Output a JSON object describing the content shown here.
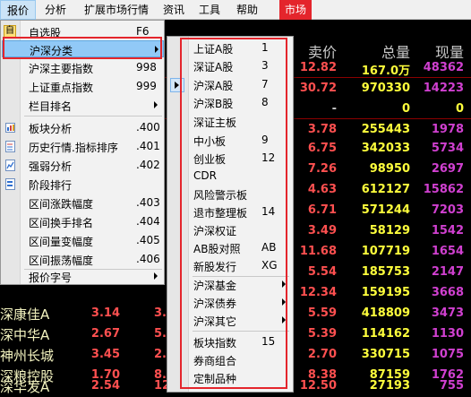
{
  "menubar": {
    "items": [
      {
        "label": "报价",
        "active": true
      },
      {
        "label": "分析"
      },
      {
        "label": "扩展市场行情"
      },
      {
        "label": "资讯"
      },
      {
        "label": "工具"
      },
      {
        "label": "帮助"
      },
      {
        "label": "市场",
        "accent": "#e4252c"
      }
    ]
  },
  "quote": {
    "headers": {
      "price": "卖价",
      "total_volume": "总量",
      "current_volume": "现量"
    },
    "rows": [
      {
        "price": "12.82",
        "volume": "167.0万",
        "now": "48362"
      },
      {
        "price": "30.72",
        "volume": "970330",
        "now": "14223"
      },
      {
        "price": "-",
        "volume": "0",
        "now": "0"
      },
      {
        "price": "3.78",
        "volume": "255443",
        "now": "1978"
      },
      {
        "price": "6.75",
        "volume": "342033",
        "now": "5734"
      },
      {
        "price": "7.26",
        "volume": "98950",
        "now": "2697"
      },
      {
        "price": "4.63",
        "volume": "612127",
        "now": "15862"
      },
      {
        "price": "6.71",
        "volume": "571244",
        "now": "7203"
      },
      {
        "price": "3.49",
        "volume": "58129",
        "now": "1542"
      },
      {
        "price": "11.68",
        "volume": "107719",
        "now": "1654"
      },
      {
        "price": "5.54",
        "volume": "185753",
        "now": "2147"
      },
      {
        "price": "12.34",
        "volume": "159195",
        "now": "3668"
      },
      {
        "price": "5.59",
        "volume": "418809",
        "now": "3473"
      },
      {
        "price": "5.39",
        "volume": "114162",
        "now": "1130"
      },
      {
        "price": "2.70",
        "volume": "330715",
        "now": "1075"
      },
      {
        "price": "8.38",
        "volume": "87159",
        "now": "1762"
      },
      {
        "price": "12.50",
        "volume": "27193",
        "now": "755"
      }
    ],
    "left_rows": [
      {
        "name": "深康佳A",
        "p1": "3.14",
        "p2": "3."
      },
      {
        "name": "深中华A",
        "p1": "2.67",
        "p2": "5."
      },
      {
        "name": "神州长城",
        "p1": "3.45",
        "p2": "2."
      },
      {
        "name": "深粮控股",
        "p1": "1.70",
        "p2": "8."
      },
      {
        "name": "深华发A",
        "p1": "2.54",
        "p2": "12."
      }
    ]
  },
  "menu": {
    "items": [
      {
        "label": "自选股",
        "key": "F6",
        "icon": "selfselect-icon",
        "checked": true
      },
      {
        "label": "沪深分类",
        "submenu": true,
        "highlight": true
      },
      {
        "label": "沪深主要指数",
        "key": "998"
      },
      {
        "label": "上证重点指数",
        "key": "999"
      },
      {
        "label": "栏目排名",
        "submenu": true
      },
      {
        "label": "板块分析",
        "key": ".400",
        "icon": "sector-analysis-icon"
      },
      {
        "label": "历史行情.指标排序",
        "key": ".401",
        "icon": "history-icon"
      },
      {
        "label": "强弱分析",
        "key": ".402",
        "icon": "strength-icon"
      },
      {
        "label": "阶段排行",
        "icon": "stage-rank-icon"
      },
      {
        "label": "区间涨跌幅度",
        "key": ".403"
      },
      {
        "label": "区间换手排名",
        "key": ".404"
      },
      {
        "label": "区间量变幅度",
        "key": ".405"
      },
      {
        "label": "区间振荡幅度",
        "key": ".406"
      },
      {
        "label": "报价字号",
        "submenu": true
      }
    ]
  },
  "submenu": {
    "items": [
      {
        "label": "上证A股",
        "key": "1"
      },
      {
        "label": "深证A股",
        "key": "3"
      },
      {
        "label": "沪深A股",
        "key": "7",
        "checked": true
      },
      {
        "label": "沪深B股",
        "key": "8"
      },
      {
        "label": "深证主板"
      },
      {
        "label": "中小板",
        "key": "9"
      },
      {
        "label": "创业板",
        "key": "12"
      },
      {
        "label": "CDR"
      },
      {
        "label": "风险警示板"
      },
      {
        "label": "退市整理板",
        "key": "14"
      },
      {
        "label": "沪深权证"
      },
      {
        "label": "AB股对照",
        "key": "AB"
      },
      {
        "label": "新股发行",
        "key": "XG"
      },
      {
        "label": "沪深基金",
        "submenu": true
      },
      {
        "label": "沪深债券",
        "submenu": true
      },
      {
        "label": "沪深其它",
        "submenu": true
      },
      {
        "label": "板块指数",
        "key": "15"
      },
      {
        "label": "券商组合"
      },
      {
        "label": "定制品种"
      }
    ]
  },
  "colors": {
    "annotation": "#e4252c",
    "menu_highlight": "#91c9f7",
    "price_up": "#ff5050",
    "volume": "#ffff3c",
    "current_volume": "#d040d0"
  }
}
